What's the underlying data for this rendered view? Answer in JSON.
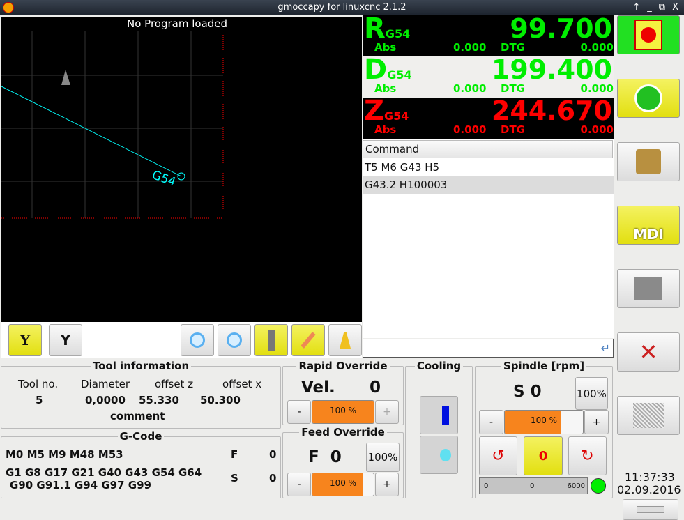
{
  "window": {
    "title": "gmoccapy for linuxcnc  2.1.2",
    "controls": [
      "↑",
      "‗",
      "⧉",
      "X"
    ]
  },
  "plot": {
    "status": "No Program loaded",
    "origin_label": "G54"
  },
  "plot_toolbar": {
    "buttons": [
      "view-y",
      "view-y-flip",
      "zoom-in",
      "zoom-out",
      "dimensions",
      "pencil",
      "clear"
    ]
  },
  "dro": [
    {
      "axis": "R",
      "system": "G54",
      "value": "99.700",
      "abs_label": "Abs",
      "abs": "0.000",
      "dtg_label": "DTG",
      "dtg": "0.000",
      "color": "#00ee00",
      "bg": "#000000"
    },
    {
      "axis": "D",
      "system": "G54",
      "value": "199.400",
      "abs_label": "Abs",
      "abs": "0.000",
      "dtg_label": "DTG",
      "dtg": "0.000",
      "color": "#00ee00",
      "bg": "#f0efed"
    },
    {
      "axis": "Z",
      "system": "G54",
      "value": "244.670",
      "abs_label": "Abs",
      "abs": "0.000",
      "dtg_label": "DTG",
      "dtg": "0.000",
      "color": "#ff0000",
      "bg": "#000000"
    }
  ],
  "mdi": {
    "header": "Command",
    "history": [
      "T5 M6 G43 H5",
      "G43.2 H100003"
    ],
    "input": ""
  },
  "tool_info": {
    "title": "Tool information",
    "headers": [
      "Tool no.",
      "Diameter",
      "offset z",
      "offset x"
    ],
    "values": [
      "5",
      "0,0000",
      "55.330",
      "50.300"
    ],
    "comment": "comment"
  },
  "gcode": {
    "title": "G-Code",
    "mcodes": "M0 M5 M9 M48 M53",
    "gcodes_line1": "G1 G8 G17 G21 G40 G43 G54 G64",
    "gcodes_line2": "G90 G91.1 G94 G97 G99",
    "f_label": "F",
    "f_value": "0",
    "s_label": "S",
    "s_value": "0"
  },
  "rapid": {
    "title": "Rapid Override",
    "label": "Vel.",
    "value": "0",
    "percent": 100,
    "percent_text": "100 %",
    "minus": "-",
    "plus": "+"
  },
  "feed": {
    "title": "Feed Override",
    "label": "F  0",
    "reset": "100%",
    "percent": 100,
    "percent_text": "100 %",
    "minus": "-",
    "plus": "+"
  },
  "cooling": {
    "title": "Cooling"
  },
  "spindle": {
    "title": "Spindle [rpm]",
    "label": "S 0",
    "reset": "100%",
    "percent": 100,
    "percent_text": "100 %",
    "minus": "-",
    "plus": "+",
    "bar_min": "0",
    "bar_value": "0",
    "bar_max": "6000",
    "status_color": "#00ee00"
  },
  "sidebar": {
    "mdi_label": "MDI"
  },
  "clock": {
    "time": "11:37:33",
    "date": "02.09.2016"
  }
}
